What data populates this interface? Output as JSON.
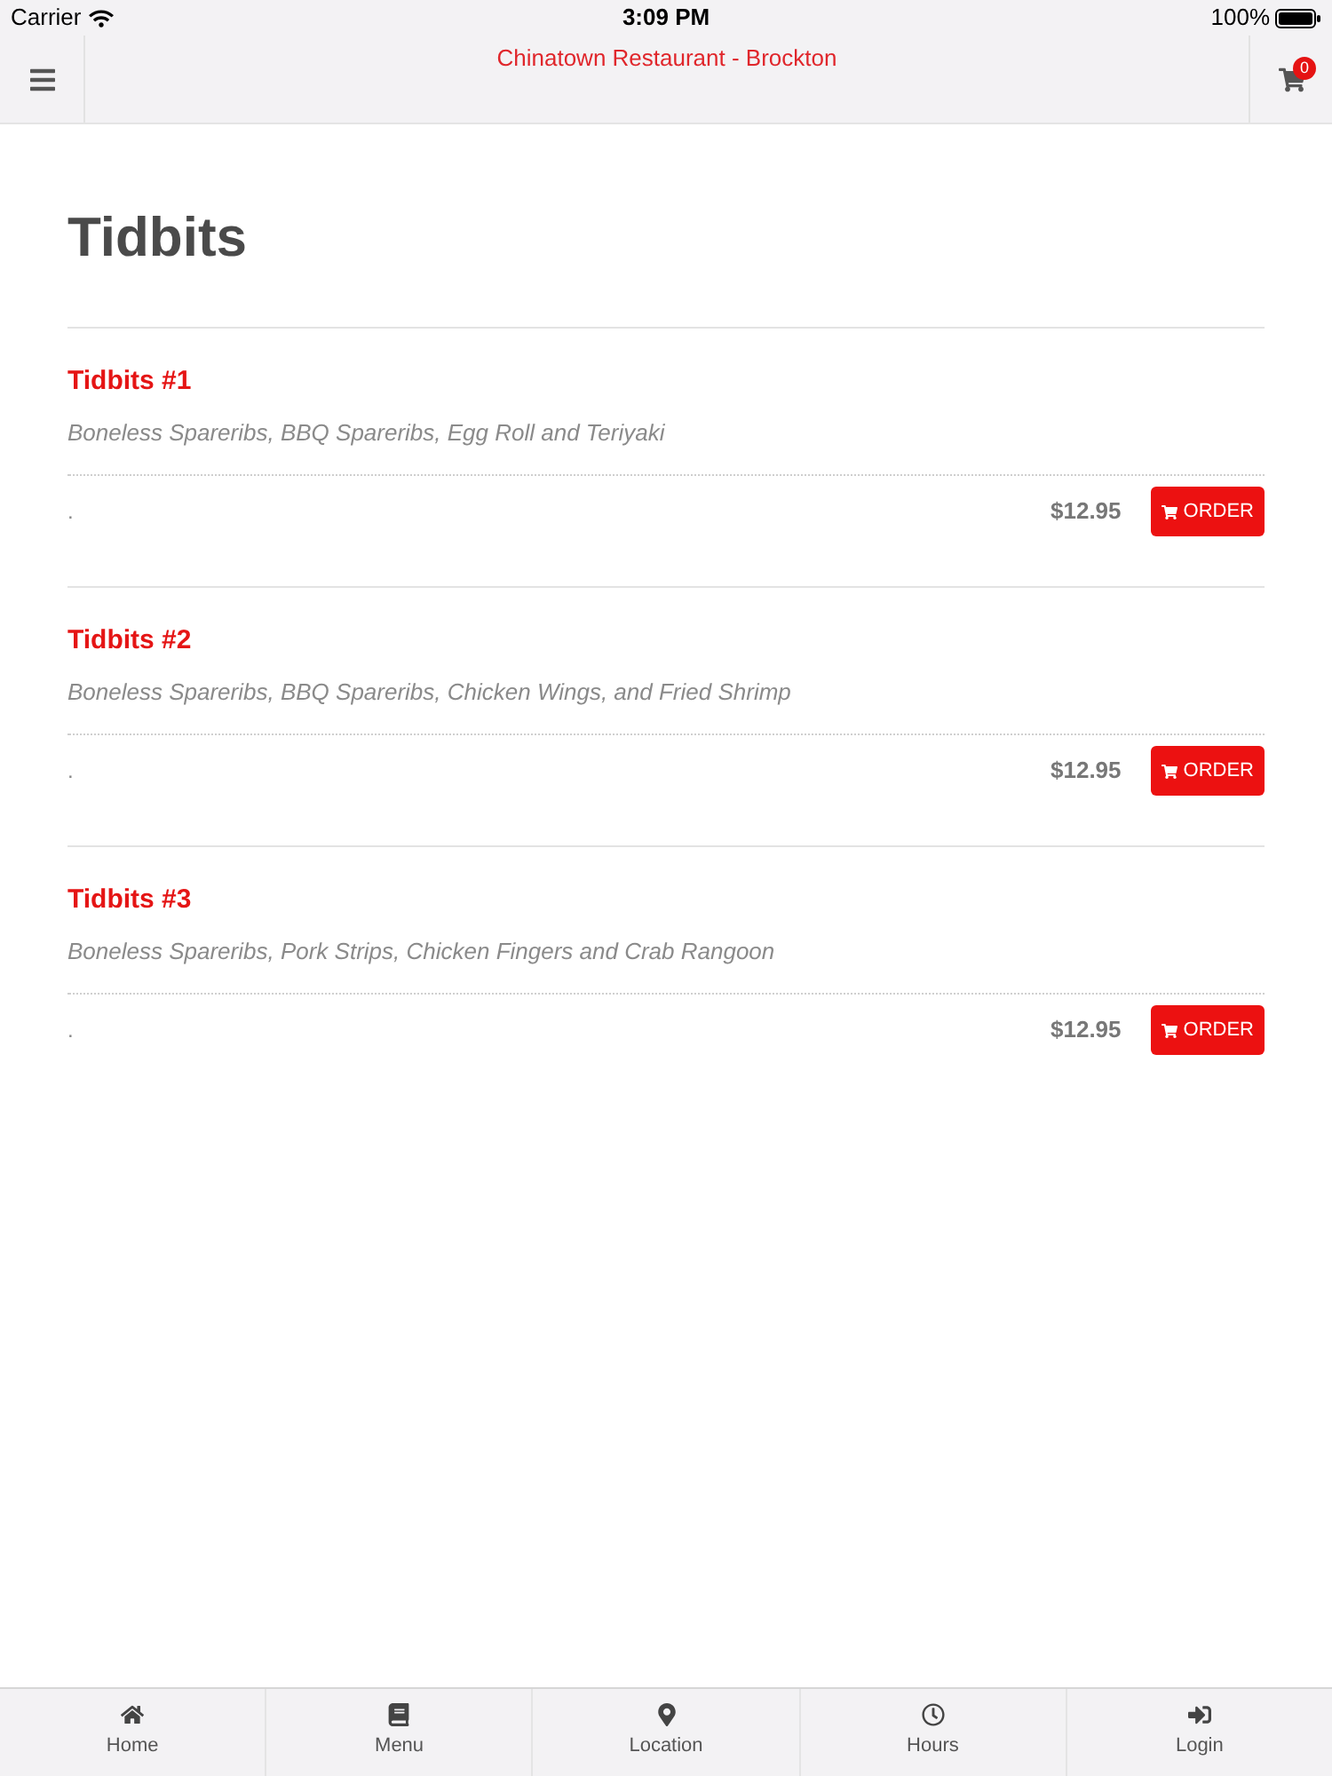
{
  "status_bar": {
    "carrier": "Carrier",
    "time": "3:09 PM",
    "battery": "100%"
  },
  "nav_bar": {
    "title": "Chinatown Restaurant - Brockton",
    "cart_count": "0"
  },
  "page_title": "Tidbits",
  "items": [
    {
      "name": "Tidbits #1",
      "description": "Boneless Spareribs, BBQ Spareribs, Egg Roll and Teriyaki",
      "note": ".",
      "price": "$12.95",
      "button": "ORDER"
    },
    {
      "name": "Tidbits #2",
      "description": "Boneless Spareribs, BBQ Spareribs, Chicken Wings, and Fried Shrimp",
      "note": ".",
      "price": "$12.95",
      "button": "ORDER"
    },
    {
      "name": "Tidbits #3",
      "description": "Boneless Spareribs, Pork Strips, Chicken Fingers and Crab Rangoon",
      "note": ".",
      "price": "$12.95",
      "button": "ORDER"
    }
  ],
  "tab_bar": {
    "tabs": [
      {
        "label": "Home"
      },
      {
        "label": "Menu"
      },
      {
        "label": "Location"
      },
      {
        "label": "Hours"
      },
      {
        "label": "Login"
      }
    ]
  }
}
